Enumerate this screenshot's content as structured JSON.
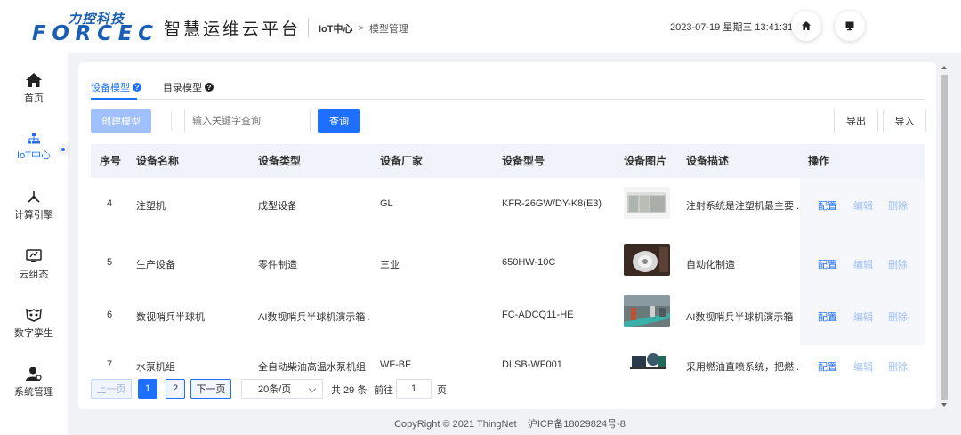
{
  "header": {
    "logo_cn": "力控科技",
    "logo_en": "FORCECON",
    "platform_name": "智慧运维云平台",
    "breadcrumb": [
      "IoT中心",
      "模型管理"
    ],
    "breadcrumb_sep": ">",
    "datetime": "2023-07-19 星期三 13:41:31",
    "icons": [
      "home-icon",
      "monitor-icon"
    ]
  },
  "sidebar": {
    "items": [
      {
        "label": "首页",
        "icon": "home-icon"
      },
      {
        "label": "IoT中心",
        "icon": "iot-network-icon",
        "active": true
      },
      {
        "label": "计算引擎",
        "icon": "compute-engine-icon"
      },
      {
        "label": "云组态",
        "icon": "cloud-config-icon"
      },
      {
        "label": "数字孪生",
        "icon": "digital-twin-icon"
      },
      {
        "label": "系统管理",
        "icon": "user-settings-icon"
      }
    ]
  },
  "tabs": [
    {
      "label": "设备模型",
      "active": true
    },
    {
      "label": "目录模型",
      "active": false
    }
  ],
  "toolbar": {
    "create_label": "创建模型",
    "search_placeholder": "输入关键字查询",
    "query_label": "查询",
    "export_label": "导出",
    "import_label": "导入"
  },
  "table": {
    "columns": [
      "序号",
      "设备名称",
      "设备类型",
      "设备厂家",
      "设备型号",
      "设备图片",
      "设备描述",
      "操作"
    ],
    "rows": [
      {
        "no": "4",
        "name": "注塑机",
        "type": "成型设备",
        "maker": "GL",
        "model": "KFR-26GW/DY-K8(E3)",
        "image": "air-conditioning-unit",
        "desc": "注射系统是注塑机最主要..."
      },
      {
        "no": "5",
        "name": "生产设备",
        "type": "零件制造",
        "maker": "三业",
        "model": "650HW-10C",
        "image": "machine-part-closeup",
        "desc": "自动化制造"
      },
      {
        "no": "6",
        "name": "数视哨兵半球机",
        "type": "AI数视哨兵半球机演示箱 ...",
        "maker": "",
        "model": "FC-ADCQ11-HE",
        "image": "factory-floor",
        "desc": "AI数视哨兵半球机演示箱 ..."
      },
      {
        "no": "7",
        "name": "水泵机组",
        "type": "全自动柴油高温水泵机组",
        "maker": "WF-BF",
        "model": "DLSB-WF001",
        "image": "water-pump-unit",
        "desc": "采用燃油直喷系统，把燃..."
      }
    ],
    "actions": {
      "config": "配置",
      "edit": "编辑",
      "delete": "删除"
    }
  },
  "pagination": {
    "prev_label": "上一页",
    "pages": [
      "1",
      "2"
    ],
    "current_page": "1",
    "next_label": "下一页",
    "page_size": "20条/页",
    "total_text": "共 29 条",
    "goto_prefix": "前往",
    "goto_value": "1",
    "goto_suffix": "页"
  },
  "footer": {
    "copyright": "CopyRight © 2021 ThingNet",
    "icp": "沪ICP备18029824号-8"
  },
  "colors": {
    "primary": "#1e6fff",
    "brand_blue": "#1a5fb4",
    "brand_green": "#2e9d4a"
  }
}
